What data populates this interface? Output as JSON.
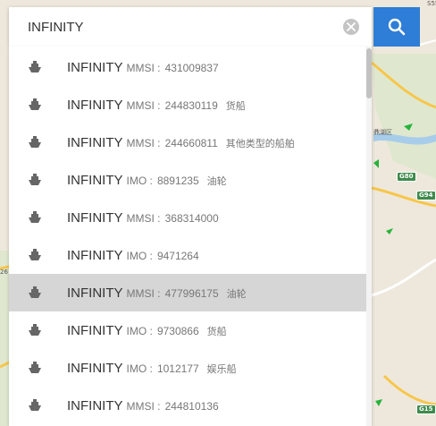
{
  "search": {
    "value": "INFINITY",
    "clear_icon": "close-icon",
    "search_icon": "search-icon"
  },
  "colors": {
    "accent": "#2e7dd6",
    "selected_row": "#d6d6d6"
  },
  "map": {
    "labels": {
      "place": "鼎湖区",
      "left_edge": "26",
      "top_edge": "S55"
    },
    "shields": [
      "G80",
      "G94",
      "G15"
    ]
  },
  "results": [
    {
      "name": "INFINITY",
      "id_label": "MMSI :",
      "id_value": "431009837",
      "type": ""
    },
    {
      "name": "INFINITY",
      "id_label": "MMSI :",
      "id_value": "244830119",
      "type": "货船"
    },
    {
      "name": "INFINITY",
      "id_label": "MMSI :",
      "id_value": "244660811",
      "type": "其他类型的船舶"
    },
    {
      "name": "INFINITY",
      "id_label": "IMO :",
      "id_value": "8891235",
      "type": "油轮"
    },
    {
      "name": "INFINITY",
      "id_label": "MMSI :",
      "id_value": "368314000",
      "type": ""
    },
    {
      "name": "INFINITY",
      "id_label": "IMO :",
      "id_value": "9471264",
      "type": ""
    },
    {
      "name": "INFINITY",
      "id_label": "MMSI :",
      "id_value": "477996175",
      "type": "油轮",
      "selected": true
    },
    {
      "name": "INFINITY",
      "id_label": "IMO :",
      "id_value": "9730866",
      "type": "货船"
    },
    {
      "name": "INFINITY",
      "id_label": "IMO :",
      "id_value": "1012177",
      "type": "娱乐船"
    },
    {
      "name": "INFINITY",
      "id_label": "MMSI :",
      "id_value": "244810136",
      "type": ""
    }
  ]
}
